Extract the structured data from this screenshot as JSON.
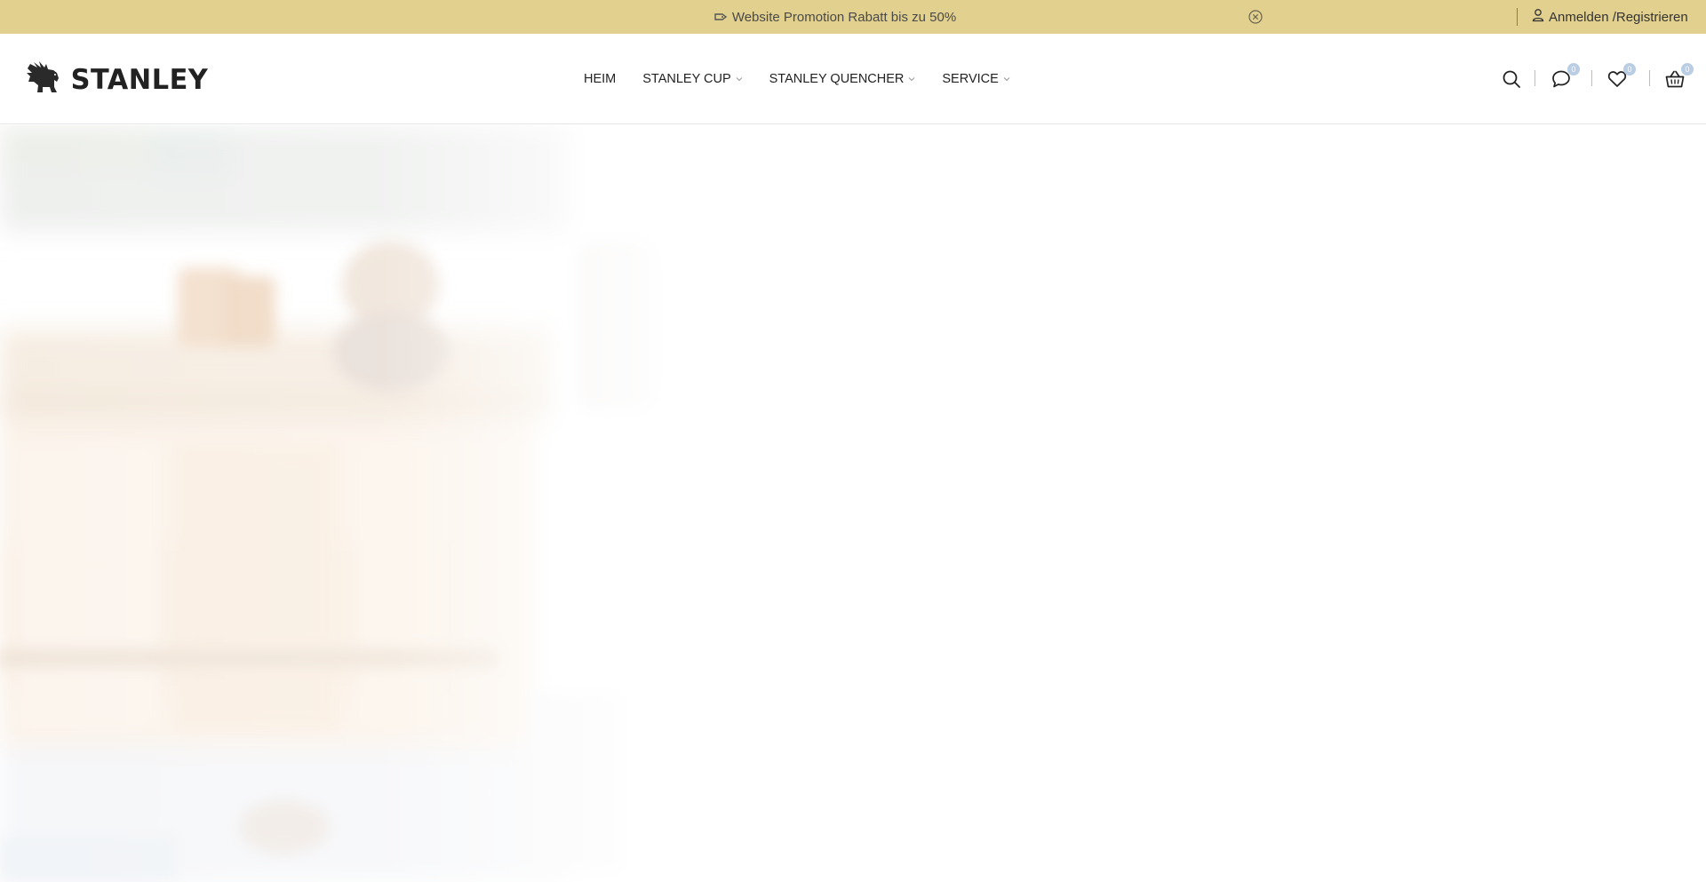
{
  "promo": {
    "message": "Website Promotion Rabatt bis zu 50%",
    "tag_icon": "price-tag-icon",
    "close_icon": "close-circle-icon",
    "background": "#e2d08e"
  },
  "account": {
    "label": "Anmelden /Registrieren",
    "icon": "user-icon"
  },
  "brand": {
    "name": "STANLEY",
    "logo_icon": "bear-logo-icon"
  },
  "nav": {
    "items": [
      {
        "label": "HEIM",
        "has_dropdown": false
      },
      {
        "label": "STANLEY CUP",
        "has_dropdown": true
      },
      {
        "label": "STANLEY QUENCHER",
        "has_dropdown": true
      },
      {
        "label": "SERVICE",
        "has_dropdown": true
      }
    ]
  },
  "header_icons": {
    "search": {
      "icon": "search-icon"
    },
    "compare": {
      "icon": "chat-bubble-icon",
      "count": "0"
    },
    "wishlist": {
      "icon": "heart-icon",
      "count": "0"
    },
    "cart": {
      "icon": "basket-icon",
      "count": "0"
    },
    "badge_color": "#b9cde3"
  }
}
